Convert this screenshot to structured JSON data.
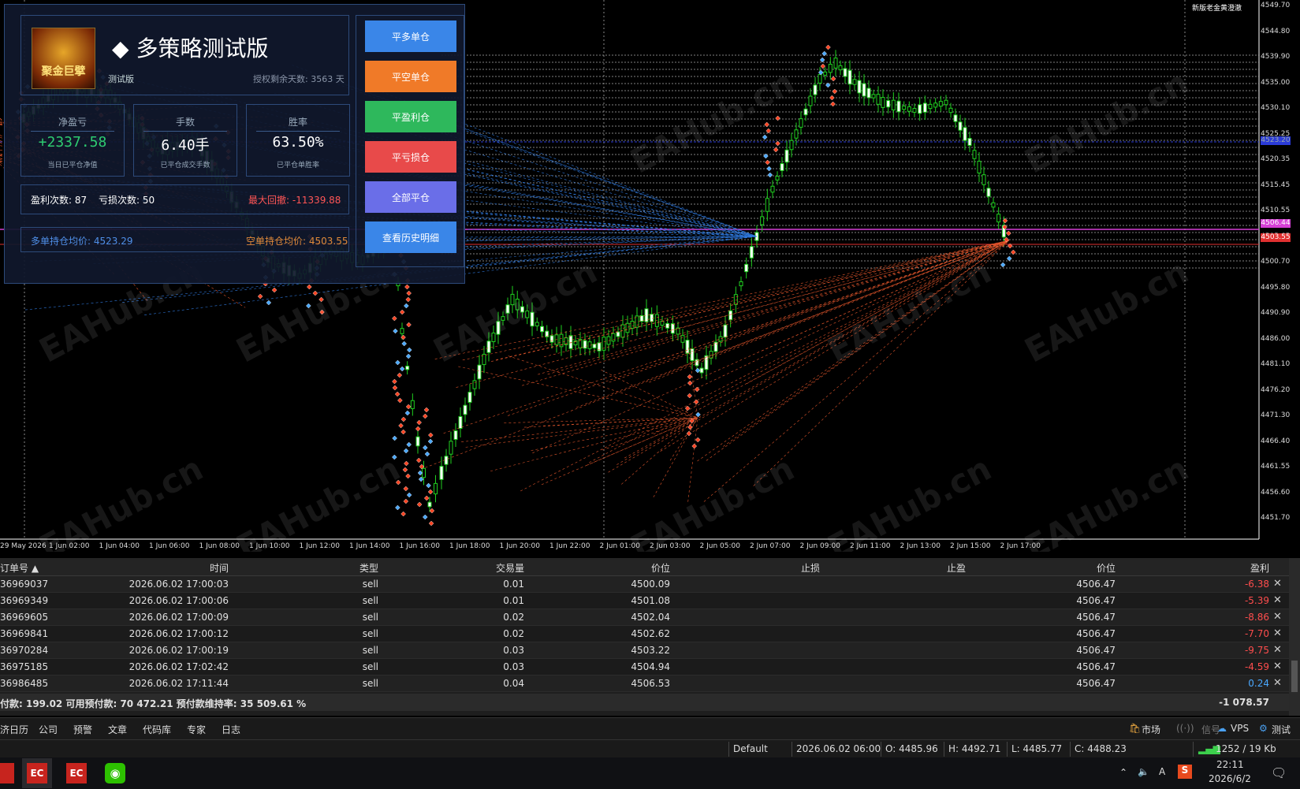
{
  "panel": {
    "title": "多策略测试版",
    "subtitle": "测试版",
    "license": "授权剩余天数: 3563 天",
    "logo_text": "聚金巨擘",
    "stats": [
      {
        "label": "净盈亏",
        "value": "+2337.58",
        "sub": "当日已平仓净值",
        "color": "#2ecc71"
      },
      {
        "label": "手数",
        "value": "6.40手",
        "sub": "已平仓成交手数",
        "color": "#ffffff"
      },
      {
        "label": "胜率",
        "value": "63.50%",
        "sub": "已平仓单胜率",
        "color": "#ffffff"
      }
    ],
    "win_count": "盈利次数:  87",
    "loss_count": "亏损次数:  50",
    "max_drawdown": "最大回撤:  -11339.88",
    "long_avg": "多单持仓均价:  4523.29",
    "short_avg": "空单持仓均价:  4503.55",
    "buttons": [
      {
        "label": "平多单仓",
        "color": "#3a86e8"
      },
      {
        "label": "平空单仓",
        "color": "#f07a28"
      },
      {
        "label": "平盈利仓",
        "color": "#2eb85c"
      },
      {
        "label": "平亏损仓",
        "color": "#e84a4a"
      },
      {
        "label": "全部平仓",
        "color": "#6a6ee8"
      },
      {
        "label": "查看历史明细",
        "color": "#3a86e8"
      }
    ]
  },
  "chart": {
    "top_right_label": "新版老金黄澄澈",
    "price_ticks": [
      "4549.70",
      "4544.80",
      "4539.90",
      "4535.00",
      "4530.10",
      "4525.25",
      "4520.35",
      "4515.45",
      "4510.55",
      "4505.65",
      "4500.70",
      "4495.80",
      "4490.90",
      "4486.00",
      "4481.10",
      "4476.20",
      "4471.30",
      "4466.40",
      "4461.55",
      "4456.60",
      "4451.70"
    ],
    "price_markers": [
      {
        "text": "4523.20",
        "color": "#2b3bd8"
      },
      {
        "text": "4506.44",
        "color": "#d63fd6"
      },
      {
        "text": "4503.55",
        "color": "#e03030"
      }
    ],
    "time_ticks": [
      "29 May 2026",
      "1 Jun 02:00",
      "1 Jun 04:00",
      "1 Jun 06:00",
      "1 Jun 08:00",
      "1 Jun 10:00",
      "1 Jun 12:00",
      "1 Jun 14:00",
      "1 Jun 16:00",
      "1 Jun 18:00",
      "1 Jun 20:00",
      "1 Jun 22:00",
      "2 Jun 01:00",
      "2 Jun 03:00",
      "2 Jun 05:00",
      "2 Jun 07:00",
      "2 Jun 09:00",
      "2 Jun 11:00",
      "2 Jun 13:00",
      "2 Jun 15:00",
      "2 Jun 17:00"
    ],
    "watermark": "EAHub.cn"
  },
  "table": {
    "columns": [
      "订单号",
      "时间",
      "类型",
      "交易量",
      "价位",
      "止损",
      "止盈",
      "价位",
      "盈利"
    ],
    "rows": [
      [
        "36969037",
        "2026.06.02 17:00:03",
        "sell",
        "0.01",
        "4500.09",
        "",
        "",
        "4506.47",
        "-6.38"
      ],
      [
        "36969349",
        "2026.06.02 17:00:06",
        "sell",
        "0.01",
        "4501.08",
        "",
        "",
        "4506.47",
        "-5.39"
      ],
      [
        "36969605",
        "2026.06.02 17:00:09",
        "sell",
        "0.02",
        "4502.04",
        "",
        "",
        "4506.47",
        "-8.86"
      ],
      [
        "36969841",
        "2026.06.02 17:00:12",
        "sell",
        "0.02",
        "4502.62",
        "",
        "",
        "4506.47",
        "-7.70"
      ],
      [
        "36970284",
        "2026.06.02 17:00:19",
        "sell",
        "0.03",
        "4503.22",
        "",
        "",
        "4506.47",
        "-9.75"
      ],
      [
        "36975185",
        "2026.06.02 17:02:42",
        "sell",
        "0.03",
        "4504.94",
        "",
        "",
        "4506.47",
        "-4.59"
      ],
      [
        "36986485",
        "2026.06.02 17:11:44",
        "sell",
        "0.04",
        "4506.53",
        "",
        "",
        "4506.47",
        "0.24"
      ]
    ],
    "balance_line": "付款: 199.02  可用预付款: 70 472.21  预付款维持率: 35 509.61 %",
    "total_profit": "-1 078.57"
  },
  "bottom_tabs": [
    "济日历",
    "公司",
    "预警",
    "文章",
    "代码库",
    "专家",
    "日志"
  ],
  "right_tabs": [
    "市场",
    "信号",
    "VPS",
    "测试"
  ],
  "status": {
    "profile": "Default",
    "datetime": "2026.06.02 06:00",
    "open": "O: 4485.96",
    "high": "H: 4492.71",
    "low": "L: 4485.77",
    "close": "C: 4488.23",
    "traffic": "1252 / 19 Kb"
  },
  "taskbar": {
    "time": "22:11",
    "date": "2026/6/2",
    "ime": "A"
  }
}
